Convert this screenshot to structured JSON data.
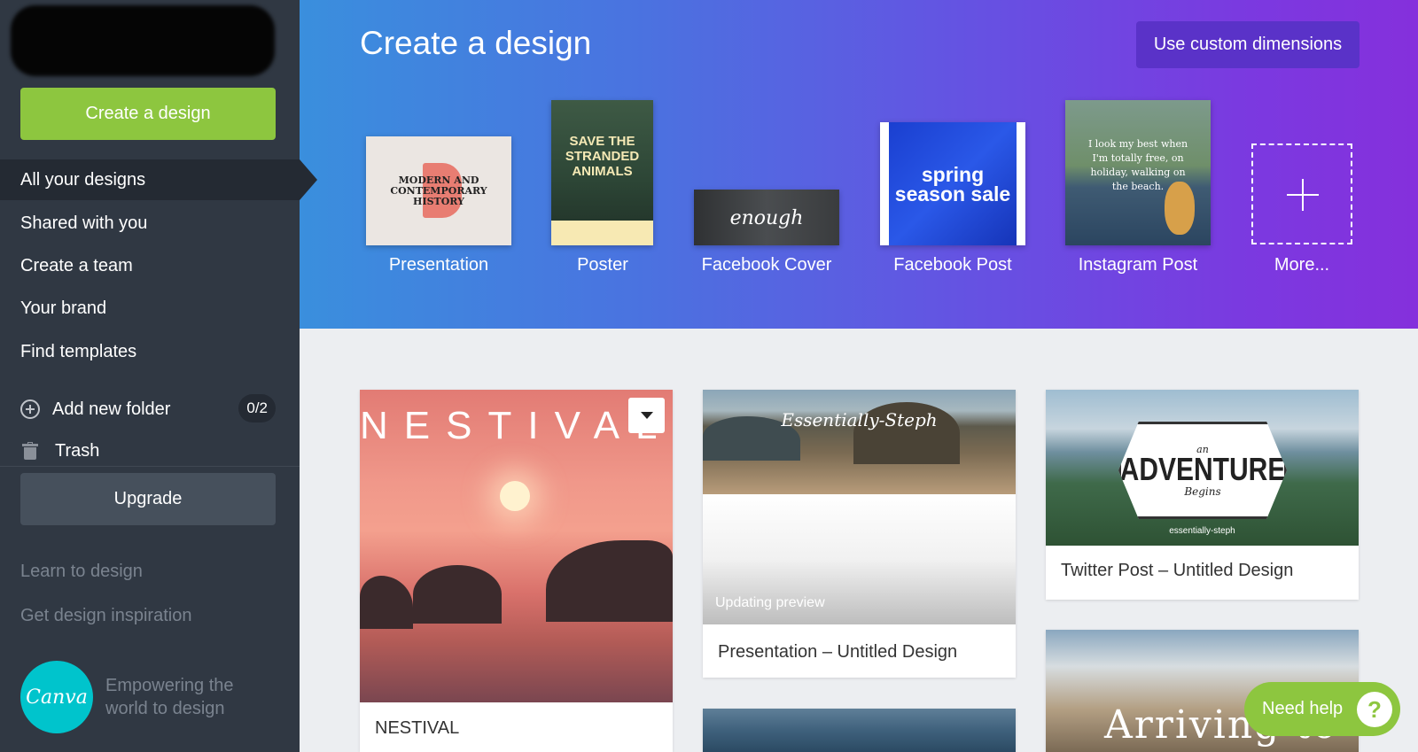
{
  "sidebar": {
    "create_button": "Create a design",
    "nav": [
      "All your designs",
      "Shared with you",
      "Create a team",
      "Your brand",
      "Find templates"
    ],
    "add_folder": "Add new folder",
    "folder_count": "0/2",
    "trash": "Trash",
    "upgrade": "Upgrade",
    "learn": "Learn to design",
    "inspiration": "Get design inspiration",
    "logo_text": "Canva",
    "tagline": "Empowering the world to design"
  },
  "hero": {
    "title": "Create a design",
    "custom_button": "Use custom dimensions",
    "types": [
      "Presentation",
      "Poster",
      "Facebook Cover",
      "Facebook Post",
      "Instagram Post",
      "More..."
    ],
    "thumb_text": {
      "presentation": "MODERN AND CONTEMPORARY HISTORY",
      "poster": "SAVE THE STRANDED ANIMALS",
      "fb_cover": "enough",
      "fb_post": "spring season sale",
      "instagram": "I look my best when I'm totally free, on holiday, walking on the beach."
    }
  },
  "designs": {
    "card1": {
      "overlay": "NESTIVAL",
      "title": "NESTIVAL"
    },
    "card2": {
      "overlay": "Essentially-Steph",
      "status": "Updating preview",
      "title": "Presentation – Untitled Design"
    },
    "card3": {
      "overlay_an": "an",
      "overlay_main": "ADVENTURE",
      "overlay_sub": "Begins",
      "overlay_small": "essentially-steph",
      "title": "Twitter Post – Untitled Design"
    },
    "card4": {
      "overlay": "Arriving to"
    }
  },
  "help": {
    "label": "Need help",
    "icon": "?"
  },
  "colors": {
    "accent_green": "#8dc63f",
    "sidebar_bg": "#303843",
    "canva_teal": "#00c4cc"
  }
}
